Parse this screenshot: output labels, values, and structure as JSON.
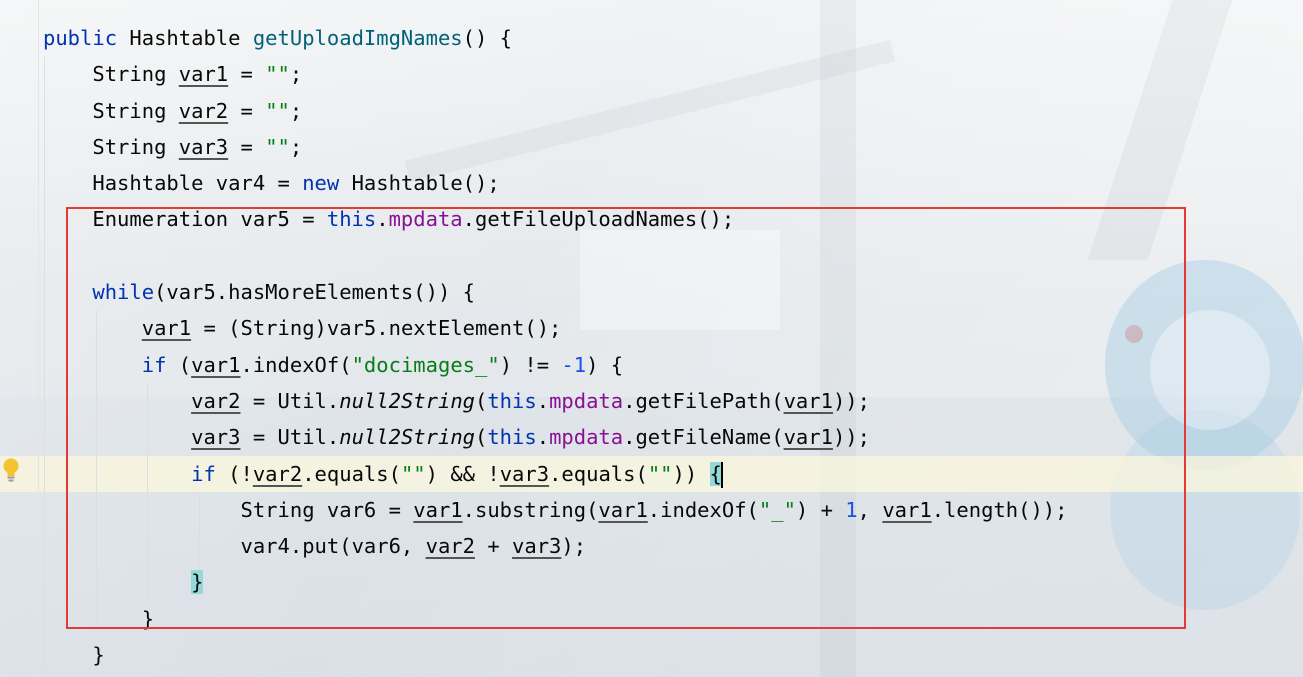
{
  "editor": {
    "lines": [
      {
        "indent": "",
        "tokens": [
          {
            "t": "public",
            "c": "kw"
          },
          {
            "t": " Hashtable "
          },
          {
            "t": "getUploadImgNames",
            "c": "fn"
          },
          {
            "t": "() {"
          }
        ]
      },
      {
        "indent": "    ",
        "tokens": [
          {
            "t": "String "
          },
          {
            "t": "var1",
            "c": "ul"
          },
          {
            "t": " = "
          },
          {
            "t": "\"\"",
            "c": "str"
          },
          {
            "t": ";"
          }
        ]
      },
      {
        "indent": "    ",
        "tokens": [
          {
            "t": "String "
          },
          {
            "t": "var2",
            "c": "ul"
          },
          {
            "t": " = "
          },
          {
            "t": "\"\"",
            "c": "str"
          },
          {
            "t": ";"
          }
        ]
      },
      {
        "indent": "    ",
        "tokens": [
          {
            "t": "String "
          },
          {
            "t": "var3",
            "c": "ul"
          },
          {
            "t": " = "
          },
          {
            "t": "\"\"",
            "c": "str"
          },
          {
            "t": ";"
          }
        ]
      },
      {
        "indent": "    ",
        "tokens": [
          {
            "t": "Hashtable var4 = "
          },
          {
            "t": "new",
            "c": "kw"
          },
          {
            "t": " Hashtable();"
          }
        ]
      },
      {
        "indent": "    ",
        "tokens": [
          {
            "t": "Enumeration var5 = "
          },
          {
            "t": "this",
            "c": "kw"
          },
          {
            "t": "."
          },
          {
            "t": "mpdata",
            "c": "fld"
          },
          {
            "t": ".getFileUploadNames();"
          }
        ]
      },
      {
        "indent": "",
        "tokens": []
      },
      {
        "indent": "    ",
        "tokens": [
          {
            "t": "while",
            "c": "kw"
          },
          {
            "t": "(var5.hasMoreElements()) {"
          }
        ]
      },
      {
        "indent": "        ",
        "tokens": [
          {
            "t": "var1",
            "c": "ul"
          },
          {
            "t": " = (String)var5.nextElement();"
          }
        ]
      },
      {
        "indent": "        ",
        "tokens": [
          {
            "t": "if",
            "c": "kw"
          },
          {
            "t": " ("
          },
          {
            "t": "var1",
            "c": "ul"
          },
          {
            "t": ".indexOf("
          },
          {
            "t": "\"docimages_\"",
            "c": "str"
          },
          {
            "t": ") != "
          },
          {
            "t": "-1",
            "c": "num"
          },
          {
            "t": ") {"
          }
        ]
      },
      {
        "indent": "            ",
        "tokens": [
          {
            "t": "var2",
            "c": "ul"
          },
          {
            "t": " = Util."
          },
          {
            "t": "null2String",
            "c": "it"
          },
          {
            "t": "("
          },
          {
            "t": "this",
            "c": "kw"
          },
          {
            "t": "."
          },
          {
            "t": "mpdata",
            "c": "fld"
          },
          {
            "t": ".getFilePath("
          },
          {
            "t": "var1",
            "c": "ul"
          },
          {
            "t": "));"
          }
        ]
      },
      {
        "indent": "            ",
        "tokens": [
          {
            "t": "var3",
            "c": "ul"
          },
          {
            "t": " = Util."
          },
          {
            "t": "null2String",
            "c": "it"
          },
          {
            "t": "("
          },
          {
            "t": "this",
            "c": "kw"
          },
          {
            "t": "."
          },
          {
            "t": "mpdata",
            "c": "fld"
          },
          {
            "t": ".getFileName("
          },
          {
            "t": "var1",
            "c": "ul"
          },
          {
            "t": "));"
          }
        ]
      },
      {
        "indent": "            ",
        "tokens": [
          {
            "t": "if",
            "c": "kw"
          },
          {
            "t": " (!"
          },
          {
            "t": "var2",
            "c": "ul"
          },
          {
            "t": ".equals("
          },
          {
            "t": "\"\"",
            "c": "str"
          },
          {
            "t": ") && !"
          },
          {
            "t": "var3",
            "c": "ul"
          },
          {
            "t": ".equals("
          },
          {
            "t": "\"\"",
            "c": "str"
          },
          {
            "t": ")) "
          },
          {
            "t": "{",
            "c": "brace"
          },
          {
            "caret": true
          }
        ]
      },
      {
        "indent": "                ",
        "tokens": [
          {
            "t": "String var6 = "
          },
          {
            "t": "var1",
            "c": "ul"
          },
          {
            "t": ".substring("
          },
          {
            "t": "var1",
            "c": "ul"
          },
          {
            "t": ".indexOf("
          },
          {
            "t": "\"_\"",
            "c": "str"
          },
          {
            "t": ") + "
          },
          {
            "t": "1",
            "c": "num"
          },
          {
            "t": ", "
          },
          {
            "t": "var1",
            "c": "ul"
          },
          {
            "t": ".length());"
          }
        ]
      },
      {
        "indent": "                ",
        "tokens": [
          {
            "t": "var4.put(var6, "
          },
          {
            "t": "var2",
            "c": "ul"
          },
          {
            "t": " + "
          },
          {
            "t": "var3",
            "c": "ul"
          },
          {
            "t": ");"
          }
        ]
      },
      {
        "indent": "            ",
        "tokens": [
          {
            "t": "}",
            "c": "brace"
          }
        ]
      },
      {
        "indent": "        ",
        "tokens": [
          {
            "t": "}"
          }
        ]
      },
      {
        "indent": "    ",
        "tokens": [
          {
            "t": "}"
          }
        ]
      }
    ],
    "intention_icon": "lightbulb-icon",
    "highlight_color": "#e53935",
    "caret_row_color": "#fcf8dc",
    "brace_match_color": "#93d9d9"
  }
}
